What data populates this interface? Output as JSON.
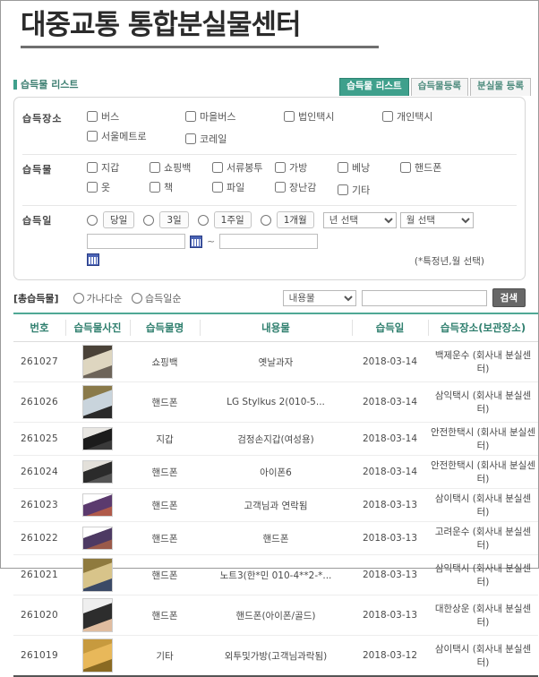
{
  "header": {
    "title": "대중교통 통합분실물센터"
  },
  "tabs": [
    {
      "label": "습득물 리스트",
      "active": true
    },
    {
      "label": "습득물등록",
      "active": false
    },
    {
      "label": "분실물 등록",
      "active": false
    }
  ],
  "section": {
    "label": "습득물 리스트"
  },
  "search_form": {
    "location": {
      "label": "습득장소",
      "options": [
        "버스",
        "마을버스",
        "법인택시",
        "개인택시",
        "서울메트로",
        "코레일"
      ]
    },
    "item": {
      "label": "습득물",
      "options": [
        "지갑",
        "쇼핑백",
        "서류봉투",
        "가방",
        "베낭",
        "핸드폰",
        "옷",
        "책",
        "파일",
        "장난감",
        "기타"
      ]
    },
    "date": {
      "label": "습득일",
      "quick_options": [
        "당일",
        "3일",
        "1주일",
        "1개월"
      ],
      "year_select": "년 선택",
      "month_select": "월 선택",
      "from_value": "",
      "to_value": "",
      "separator": "~",
      "note": "(*특정년,월 선택)"
    }
  },
  "toolbar": {
    "total_label": "[총습득물]",
    "sort_options": [
      "가나다순",
      "습득일순"
    ],
    "filter_select": "내용물",
    "keyword_value": "",
    "search_button": "검색"
  },
  "table": {
    "headers": [
      "번호",
      "습득물사진",
      "습득물명",
      "내용물",
      "습득일",
      "습득장소(보관장소)"
    ],
    "rows": [
      {
        "no": "261027",
        "name": "쇼핑백",
        "content": "옛날과자",
        "date": "2018-03-14",
        "place": "백제운수 (회사내 분실센터)",
        "thumb_colors": [
          "#4a4238",
          "#ded6c0",
          "#6d6459"
        ],
        "thumb_tall": true
      },
      {
        "no": "261026",
        "name": "핸드폰",
        "content": "LG Stylkus 2(010-5...",
        "date": "2018-03-14",
        "place": "삼익택시 (회사내 분실센터)",
        "thumb_colors": [
          "#8a7a4a",
          "#c9d4dc",
          "#2a2a2a"
        ],
        "thumb_tall": true
      },
      {
        "no": "261025",
        "name": "지갑",
        "content": "검정손지갑(여성용)",
        "date": "2018-03-14",
        "place": "안전한택시 (회사내 분실센터)",
        "thumb_colors": [
          "#e8e6e2",
          "#1c1c1c",
          "#3a3a3a"
        ],
        "thumb_tall": false
      },
      {
        "no": "261024",
        "name": "핸드폰",
        "content": "아이폰6",
        "date": "2018-03-14",
        "place": "안전한택시 (회사내 분실센터)",
        "thumb_colors": [
          "#e3e0da",
          "#2b2b2b",
          "#545454"
        ],
        "thumb_tall": false
      },
      {
        "no": "261023",
        "name": "핸드폰",
        "content": "고객님과 연락됨",
        "date": "2018-03-13",
        "place": "삼이택시 (회사내 분실센터)",
        "thumb_colors": [
          "#ffffff",
          "#5b3a6e",
          "#b05a4a"
        ],
        "thumb_tall": false
      },
      {
        "no": "261022",
        "name": "핸드폰",
        "content": "핸드폰",
        "date": "2018-03-13",
        "place": "고려운수 (회사내 분실센터)",
        "thumb_colors": [
          "#ffffff",
          "#4d3a63",
          "#9a5a4a"
        ],
        "thumb_tall": false
      },
      {
        "no": "261021",
        "name": "핸드폰",
        "content": "노트3(한*민 010-4**2-*...",
        "date": "2018-03-13",
        "place": "삼익택시 (회사내 분실센터)",
        "thumb_colors": [
          "#8f7a3e",
          "#d8c48a",
          "#3b4a66"
        ],
        "thumb_tall": true
      },
      {
        "no": "261020",
        "name": "핸드폰",
        "content": "핸드폰(아이폰/골드)",
        "date": "2018-03-13",
        "place": "대한상운 (회사내 분실센터)",
        "thumb_colors": [
          "#efefef",
          "#2d2d2d",
          "#e0bda0"
        ],
        "thumb_tall": true
      },
      {
        "no": "261019",
        "name": "기타",
        "content": "외투및가방(고객님과락됨)",
        "date": "2018-03-12",
        "place": "삼이택시 (회사내 분실센터)",
        "thumb_colors": [
          "#c79a3e",
          "#e8b85a",
          "#8a6a22"
        ],
        "thumb_tall": true
      }
    ]
  },
  "colors": {
    "accent": "#3fa08c",
    "header_text": "#2f7f6e",
    "title": "#2b2b2b"
  }
}
